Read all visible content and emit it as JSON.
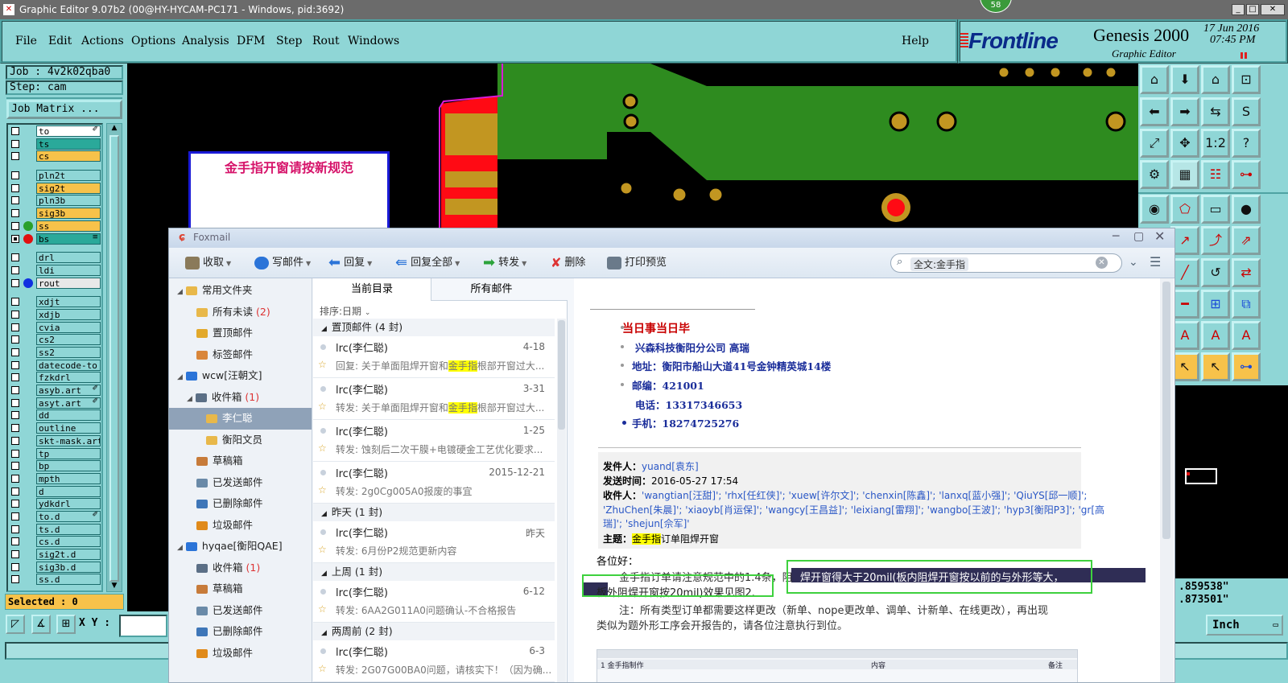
{
  "window": {
    "title": "Graphic Editor 9.07b2 (00@HY-HYCAM-PC171 - Windows, pid:3692)",
    "badge": "58"
  },
  "menu": {
    "items": [
      "File",
      "Edit",
      "Actions",
      "Options",
      "Analysis",
      "DFM",
      "Step",
      "Rout",
      "Windows"
    ],
    "help": "Help"
  },
  "brand": {
    "logo": "Frontline",
    "product": "Genesis 2000",
    "subtitle": "Graphic Editor",
    "date": "17 Jun 2016",
    "time": "07:45 PM"
  },
  "job": {
    "job_label": "Job : 4v2k02qba0",
    "step_label": "Step: cam",
    "matrix_button": "Job Matrix ..."
  },
  "layers": [
    {
      "name": "to",
      "color": "#ffffff",
      "checked": false,
      "dot": "",
      "mark": "✐"
    },
    {
      "name": "ts",
      "color": "#2aa99a",
      "checked": false,
      "dot": "",
      "mark": ""
    },
    {
      "name": "cs",
      "color": "#f7c24a",
      "checked": false,
      "dot": "",
      "mark": ""
    },
    {
      "name": "",
      "color": "#8fd6d6",
      "checked": false,
      "dot": "",
      "mark": "",
      "gap": true
    },
    {
      "name": "pln2t",
      "color": "#8fd6d6",
      "checked": false,
      "dot": "",
      "mark": ""
    },
    {
      "name": "sig2t",
      "color": "#f7c24a",
      "checked": false,
      "dot": "",
      "mark": ""
    },
    {
      "name": "pln3b",
      "color": "#8fd6d6",
      "checked": false,
      "dot": "",
      "mark": ""
    },
    {
      "name": "sig3b",
      "color": "#f7c24a",
      "checked": false,
      "dot": "",
      "mark": ""
    },
    {
      "name": "ss",
      "color": "#f7c24a",
      "checked": false,
      "dot": "#2aa02a",
      "mark": ""
    },
    {
      "name": "bs",
      "color": "#2aa99a",
      "checked": true,
      "dot": "#e01010",
      "mark": "≡"
    },
    {
      "name": "",
      "color": "#8fd6d6",
      "checked": false,
      "dot": "",
      "mark": "",
      "gap": true
    },
    {
      "name": "drl",
      "color": "#8fd6d6",
      "checked": false,
      "dot": "",
      "mark": ""
    },
    {
      "name": "ldi",
      "color": "#8fd6d6",
      "checked": false,
      "dot": "",
      "mark": ""
    },
    {
      "name": "rout",
      "color": "#e8e8e8",
      "checked": false,
      "dot": "#1030e0",
      "mark": ""
    },
    {
      "name": "",
      "color": "#8fd6d6",
      "checked": false,
      "dot": "",
      "mark": "",
      "gap": true
    },
    {
      "name": "xdjt",
      "color": "#8fd6d6",
      "checked": false,
      "dot": "",
      "mark": ""
    },
    {
      "name": "xdjb",
      "color": "#8fd6d6",
      "checked": false,
      "dot": "",
      "mark": ""
    },
    {
      "name": "cvia",
      "color": "#8fd6d6",
      "checked": false,
      "dot": "",
      "mark": ""
    },
    {
      "name": "cs2",
      "color": "#8fd6d6",
      "checked": false,
      "dot": "",
      "mark": ""
    },
    {
      "name": "ss2",
      "color": "#8fd6d6",
      "checked": false,
      "dot": "",
      "mark": ""
    },
    {
      "name": "datecode-to",
      "color": "#8fd6d6",
      "checked": false,
      "dot": "",
      "mark": ""
    },
    {
      "name": "fzkdrl",
      "color": "#8fd6d6",
      "checked": false,
      "dot": "",
      "mark": ""
    },
    {
      "name": "asyb.art",
      "color": "#8fd6d6",
      "checked": false,
      "dot": "",
      "mark": "✐"
    },
    {
      "name": "asyt.art",
      "color": "#8fd6d6",
      "checked": false,
      "dot": "",
      "mark": "✐"
    },
    {
      "name": "dd",
      "color": "#8fd6d6",
      "checked": false,
      "dot": "",
      "mark": ""
    },
    {
      "name": "outline",
      "color": "#8fd6d6",
      "checked": false,
      "dot": "",
      "mark": ""
    },
    {
      "name": "skt-mask.art",
      "color": "#8fd6d6",
      "checked": false,
      "dot": "",
      "mark": ""
    },
    {
      "name": "tp",
      "color": "#8fd6d6",
      "checked": false,
      "dot": "",
      "mark": ""
    },
    {
      "name": "bp",
      "color": "#8fd6d6",
      "checked": false,
      "dot": "",
      "mark": ""
    },
    {
      "name": "mpth",
      "color": "#8fd6d6",
      "checked": false,
      "dot": "",
      "mark": ""
    },
    {
      "name": "d",
      "color": "#8fd6d6",
      "checked": false,
      "dot": "",
      "mark": ""
    },
    {
      "name": "ydkdrl",
      "color": "#8fd6d6",
      "checked": false,
      "dot": "",
      "mark": ""
    },
    {
      "name": "to.d",
      "color": "#8fd6d6",
      "checked": false,
      "dot": "",
      "mark": "✐"
    },
    {
      "name": "ts.d",
      "color": "#8fd6d6",
      "checked": false,
      "dot": "",
      "mark": ""
    },
    {
      "name": "cs.d",
      "color": "#8fd6d6",
      "checked": false,
      "dot": "",
      "mark": ""
    },
    {
      "name": "sig2t.d",
      "color": "#8fd6d6",
      "checked": false,
      "dot": "",
      "mark": ""
    },
    {
      "name": "sig3b.d",
      "color": "#8fd6d6",
      "checked": false,
      "dot": "",
      "mark": ""
    },
    {
      "name": "ss.d",
      "color": "#8fd6d6",
      "checked": false,
      "dot": "",
      "mark": ""
    }
  ],
  "status": {
    "selected": "Selected : 0",
    "xy_label": "X Y :",
    "coord_x": ".859538\"",
    "coord_y": ".873501\"",
    "units": "Inch"
  },
  "note": {
    "text": "金手指开窗请按新规范"
  },
  "foxmail": {
    "title": "Foxmail",
    "toolbar": {
      "receive": "收取",
      "compose": "写邮件",
      "reply": "回复",
      "reply_all": "回复全部",
      "forward": "转发",
      "delete": "删除",
      "print": "打印预览"
    },
    "search": {
      "value": "全文:金手指"
    },
    "folders": [
      {
        "label": "常用文件夹",
        "count": "",
        "indent": 0,
        "kind": "group"
      },
      {
        "label": "所有未读",
        "count": "(2)",
        "indent": 2,
        "kind": "folder"
      },
      {
        "label": "置顶邮件",
        "count": "",
        "indent": 2,
        "kind": "star"
      },
      {
        "label": "标签邮件",
        "count": "",
        "indent": 2,
        "kind": "tag"
      },
      {
        "label": "wcw[汪朝文]",
        "count": "",
        "indent": 0,
        "kind": "account"
      },
      {
        "label": "收件箱",
        "count": "(1)",
        "indent": 1,
        "kind": "inbox"
      },
      {
        "label": "李仁聪",
        "count": "",
        "indent": 3,
        "kind": "folder",
        "selected": true
      },
      {
        "label": "衡阳文员",
        "count": "",
        "indent": 3,
        "kind": "folder"
      },
      {
        "label": "草稿箱",
        "count": "",
        "indent": 2,
        "kind": "draft"
      },
      {
        "label": "已发送邮件",
        "count": "",
        "indent": 2,
        "kind": "sent"
      },
      {
        "label": "已删除邮件",
        "count": "",
        "indent": 2,
        "kind": "trash"
      },
      {
        "label": "垃圾邮件",
        "count": "",
        "indent": 2,
        "kind": "junk"
      },
      {
        "label": "hyqae[衡阳QAE]",
        "count": "",
        "indent": 0,
        "kind": "account"
      },
      {
        "label": "收件箱",
        "count": "(1)",
        "indent": 2,
        "kind": "inbox"
      },
      {
        "label": "草稿箱",
        "count": "",
        "indent": 2,
        "kind": "draft"
      },
      {
        "label": "已发送邮件",
        "count": "",
        "indent": 2,
        "kind": "sent"
      },
      {
        "label": "已删除邮件",
        "count": "",
        "indent": 2,
        "kind": "trash"
      },
      {
        "label": "垃圾邮件",
        "count": "",
        "indent": 2,
        "kind": "junk"
      }
    ],
    "list_tabs": [
      "当前目录",
      "所有邮件"
    ],
    "sort_label": "排序:日期",
    "groups": [
      {
        "label": "置顶邮件 (4 封)",
        "messages": [
          {
            "from": "lrc(李仁聪)",
            "date": "4-18",
            "pre": "回复: 关于单面阻焊开窗和",
            "hl": "金手指",
            "post": "根部开窗过大..."
          },
          {
            "from": "lrc(李仁聪)",
            "date": "3-31",
            "pre": "转发: 关于单面阻焊开窗和",
            "hl": "金手指",
            "post": "根部开窗过大..."
          },
          {
            "from": "lrc(李仁聪)",
            "date": "1-25",
            "pre": "转发: 蚀刻后二次干膜+电镀硬金工艺优化要求...",
            "hl": "",
            "post": ""
          },
          {
            "from": "lrc(李仁聪)",
            "date": "2015-12-21",
            "pre": "转发: 2g0Cg005A0报废的事宜",
            "hl": "",
            "post": ""
          }
        ]
      },
      {
        "label": "昨天 (1 封)",
        "messages": [
          {
            "from": "lrc(李仁聪)",
            "date": "昨天",
            "pre": "转发: 6月份P2规范更新内容",
            "hl": "",
            "post": ""
          }
        ]
      },
      {
        "label": "上周 (1 封)",
        "messages": [
          {
            "from": "lrc(李仁聪)",
            "date": "6-12",
            "pre": "转发: 6AA2G011A0问题确认-不合格报告",
            "hl": "",
            "post": ""
          }
        ]
      },
      {
        "label": "两周前 (2 封)",
        "messages": [
          {
            "from": "lrc(李仁聪)",
            "date": "6-3",
            "pre": "转发: 2G07G00BA0问题，请核实下！（因为确...",
            "hl": "",
            "post": ""
          }
        ]
      }
    ],
    "reader": {
      "sig": [
        "当日事当日毕",
        "兴森科技衡阳分公司    高瑞",
        "地址：衡阳市船山大道41号金钟精英城14楼",
        "邮编：421001",
        "电话：13317346653",
        "手机：18274725276"
      ],
      "from_key": "发件人：",
      "from_val": "yuand[袁东]",
      "time_key": "发送时间：",
      "time_val": "2016-05-27 17:54",
      "to_key": "收件人：",
      "to_val1": "'wangtian[汪甜]'; 'rhx[任红侠]'; 'xuew[许尔文]'; 'chenxin[陈鑫]'; 'lanxq[蓝小强]'; 'QiuYS[邱一顺]';",
      "to_val2": "'ZhuChen[朱晨]'; 'xiaoyb[肖运保]'; 'wangcy[王昌益]'; 'leixiang[雷翔]'; 'wangbo[王波]'; 'hyp3[衡阳P3]'; 'gr[高",
      "to_val3": "瑞]'; 'shejun[佘军]'",
      "subj_key": "主题：",
      "subj_hl": "金手指",
      "subj_rest": "订单阻焊开窗",
      "greeting": "各位好：",
      "body1a": "金手指订单请注意规范中的1.4条，阻",
      "body1b": "焊开窗得大于20mil(板内阻焊开窗按以前的与外形等大，",
      "body2": "板外阻焊开窗按20mil)效果见图2.",
      "body3": "注：所有类型订单都需要这样更改（新单、nope更改单、调单、计新单、在线更改），再出现",
      "body4": "类似为题外形工序会开报告的，请各位注意执行到位。",
      "img_row": "1 金手指制作",
      "img_col": "内容",
      "img_col2": "备注"
    }
  }
}
